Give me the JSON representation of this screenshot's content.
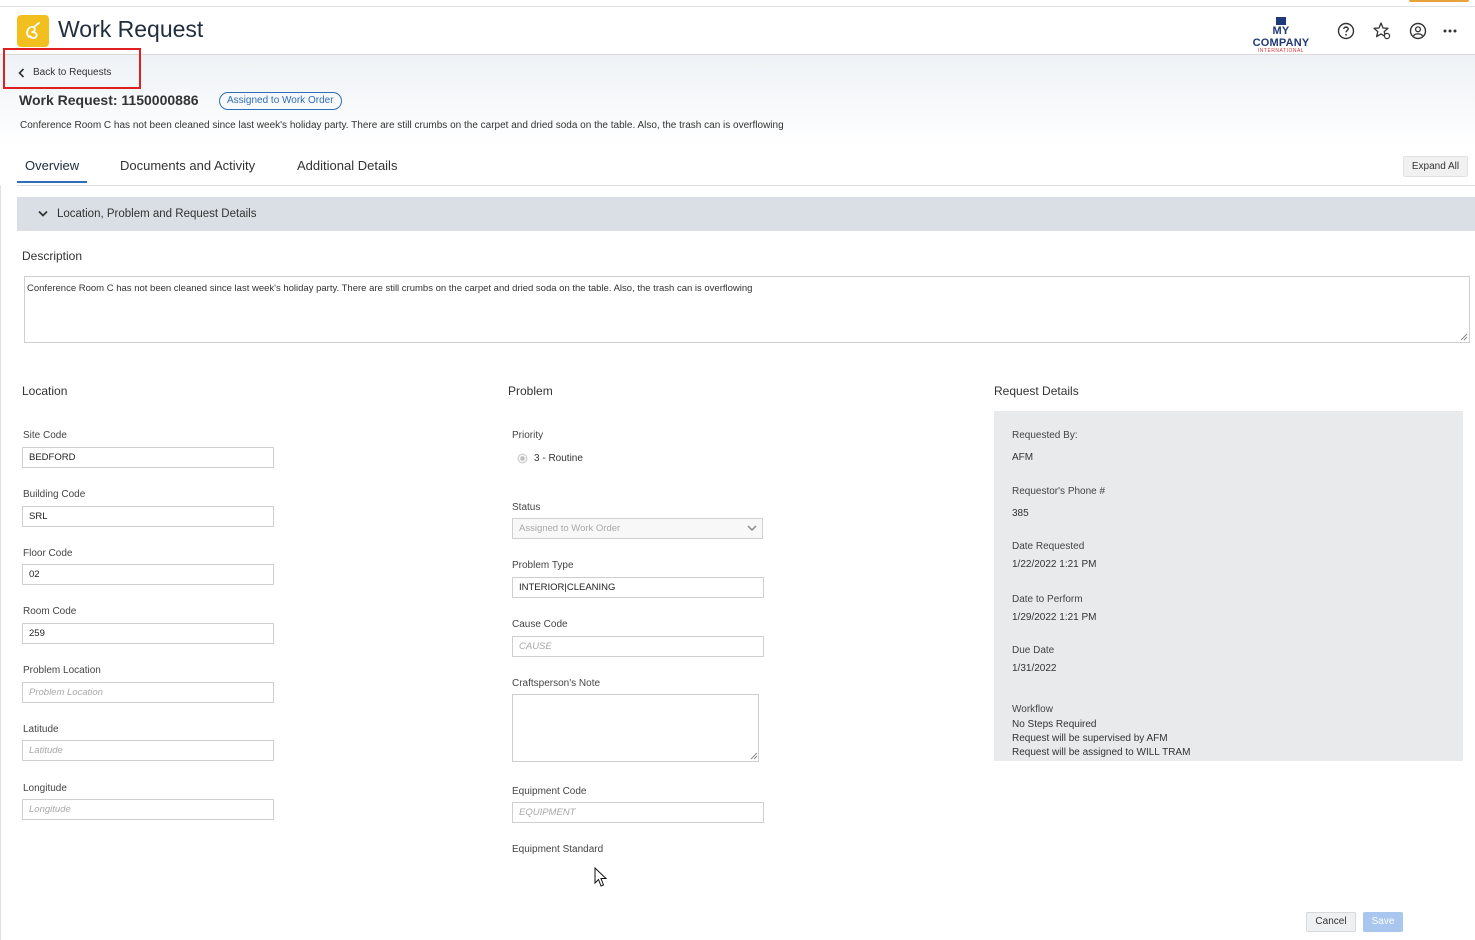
{
  "header": {
    "title": "Work Request",
    "company_main": "MY COMPANY",
    "company_sub": "INTERNATIONAL",
    "icons": [
      "help-icon",
      "favorites-icon",
      "profile-icon",
      "more-icon"
    ]
  },
  "back_link": "Back to Requests",
  "request": {
    "title": "Work Request: 1150000886",
    "status": "Assigned to Work Order",
    "summary": "Conference Room C has not been cleaned since last week's holiday party. There are still crumbs on the carpet and dried soda on the table. Also, the trash can is overflowing"
  },
  "tabs": [
    {
      "label": "Overview",
      "active": true
    },
    {
      "label": "Documents and Activity",
      "active": false
    },
    {
      "label": "Additional Details",
      "active": false
    }
  ],
  "expand_all": "Expand All",
  "section": {
    "title": "Location, Problem and Request Details",
    "description_label": "Description",
    "description_value": "Conference Room C has not been cleaned since last week's holiday party.  There are still crumbs on the carpet and dried soda on the table.  Also, the trash can is overflowing"
  },
  "location": {
    "heading": "Location",
    "site_code_label": "Site Code",
    "site_code": "BEDFORD",
    "building_code_label": "Building Code",
    "building_code": "SRL",
    "floor_code_label": "Floor Code",
    "floor_code": "02",
    "room_code_label": "Room Code",
    "room_code": "259",
    "problem_location_label": "Problem Location",
    "problem_location_placeholder": "Problem Location",
    "latitude_label": "Latitude",
    "latitude_placeholder": "Latitude",
    "longitude_label": "Longitude",
    "longitude_placeholder": "Longitude"
  },
  "problem": {
    "heading": "Problem",
    "priority_label": "Priority",
    "priority_value": "3 - Routine",
    "status_label": "Status",
    "status_value": "Assigned to Work Order",
    "problem_type_label": "Problem Type",
    "problem_type": "INTERIOR|CLEANING",
    "cause_code_label": "Cause Code",
    "cause_code_placeholder": "CAUSE",
    "craftsperson_note_label": "Craftsperson's Note",
    "equipment_code_label": "Equipment Code",
    "equipment_code_placeholder": "EQUIPMENT",
    "equipment_standard_label": "Equipment Standard"
  },
  "request_details": {
    "heading": "Request Details",
    "requested_by_label": "Requested By:",
    "requested_by": "AFM",
    "phone_label": "Requestor's Phone #",
    "phone": "385",
    "date_requested_label": "Date Requested",
    "date_requested": "1/22/2022 1:21 PM",
    "date_to_perform_label": "Date to Perform",
    "date_to_perform": "1/29/2022 1:21 PM",
    "due_date_label": "Due Date",
    "due_date": "1/31/2022",
    "workflow_label": "Workflow",
    "workflow_lines": [
      "No Steps Required",
      "Request will be supervised by AFM",
      "Request will be assigned to WILL TRAM"
    ]
  },
  "actions": {
    "cancel": "Cancel",
    "save": "Save"
  },
  "colors": {
    "accent": "#2f6fb7",
    "logo": "#f2c01e",
    "highlight_box": "#e02020"
  }
}
